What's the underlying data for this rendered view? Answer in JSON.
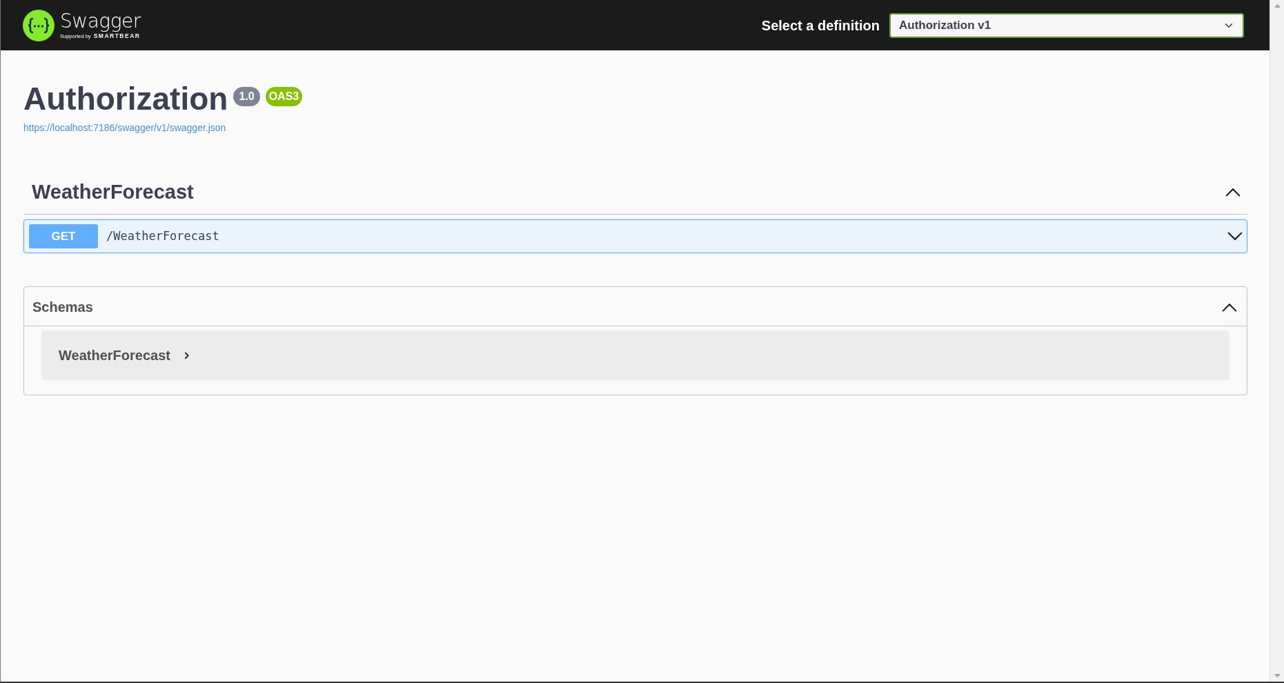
{
  "header": {
    "logo": {
      "name": "Swagger",
      "tagline_prefix": "Supported by",
      "tagline_brand": "SMARTBEAR"
    },
    "definition_label": "Select a definition",
    "definition_select": {
      "value": "Authorization v1"
    }
  },
  "info": {
    "title": "Authorization",
    "version": "1.0",
    "spec_badge": "OAS3",
    "spec_url": "https://localhost:7186/swagger/v1/swagger.json"
  },
  "tags": [
    {
      "name": "WeatherForecast",
      "expanded": true,
      "operations": [
        {
          "method": "GET",
          "path": "/WeatherForecast",
          "expanded": false
        }
      ]
    }
  ],
  "schemas": {
    "title": "Schemas",
    "expanded": true,
    "models": [
      {
        "name": "WeatherForecast",
        "expanded": false
      }
    ]
  }
}
